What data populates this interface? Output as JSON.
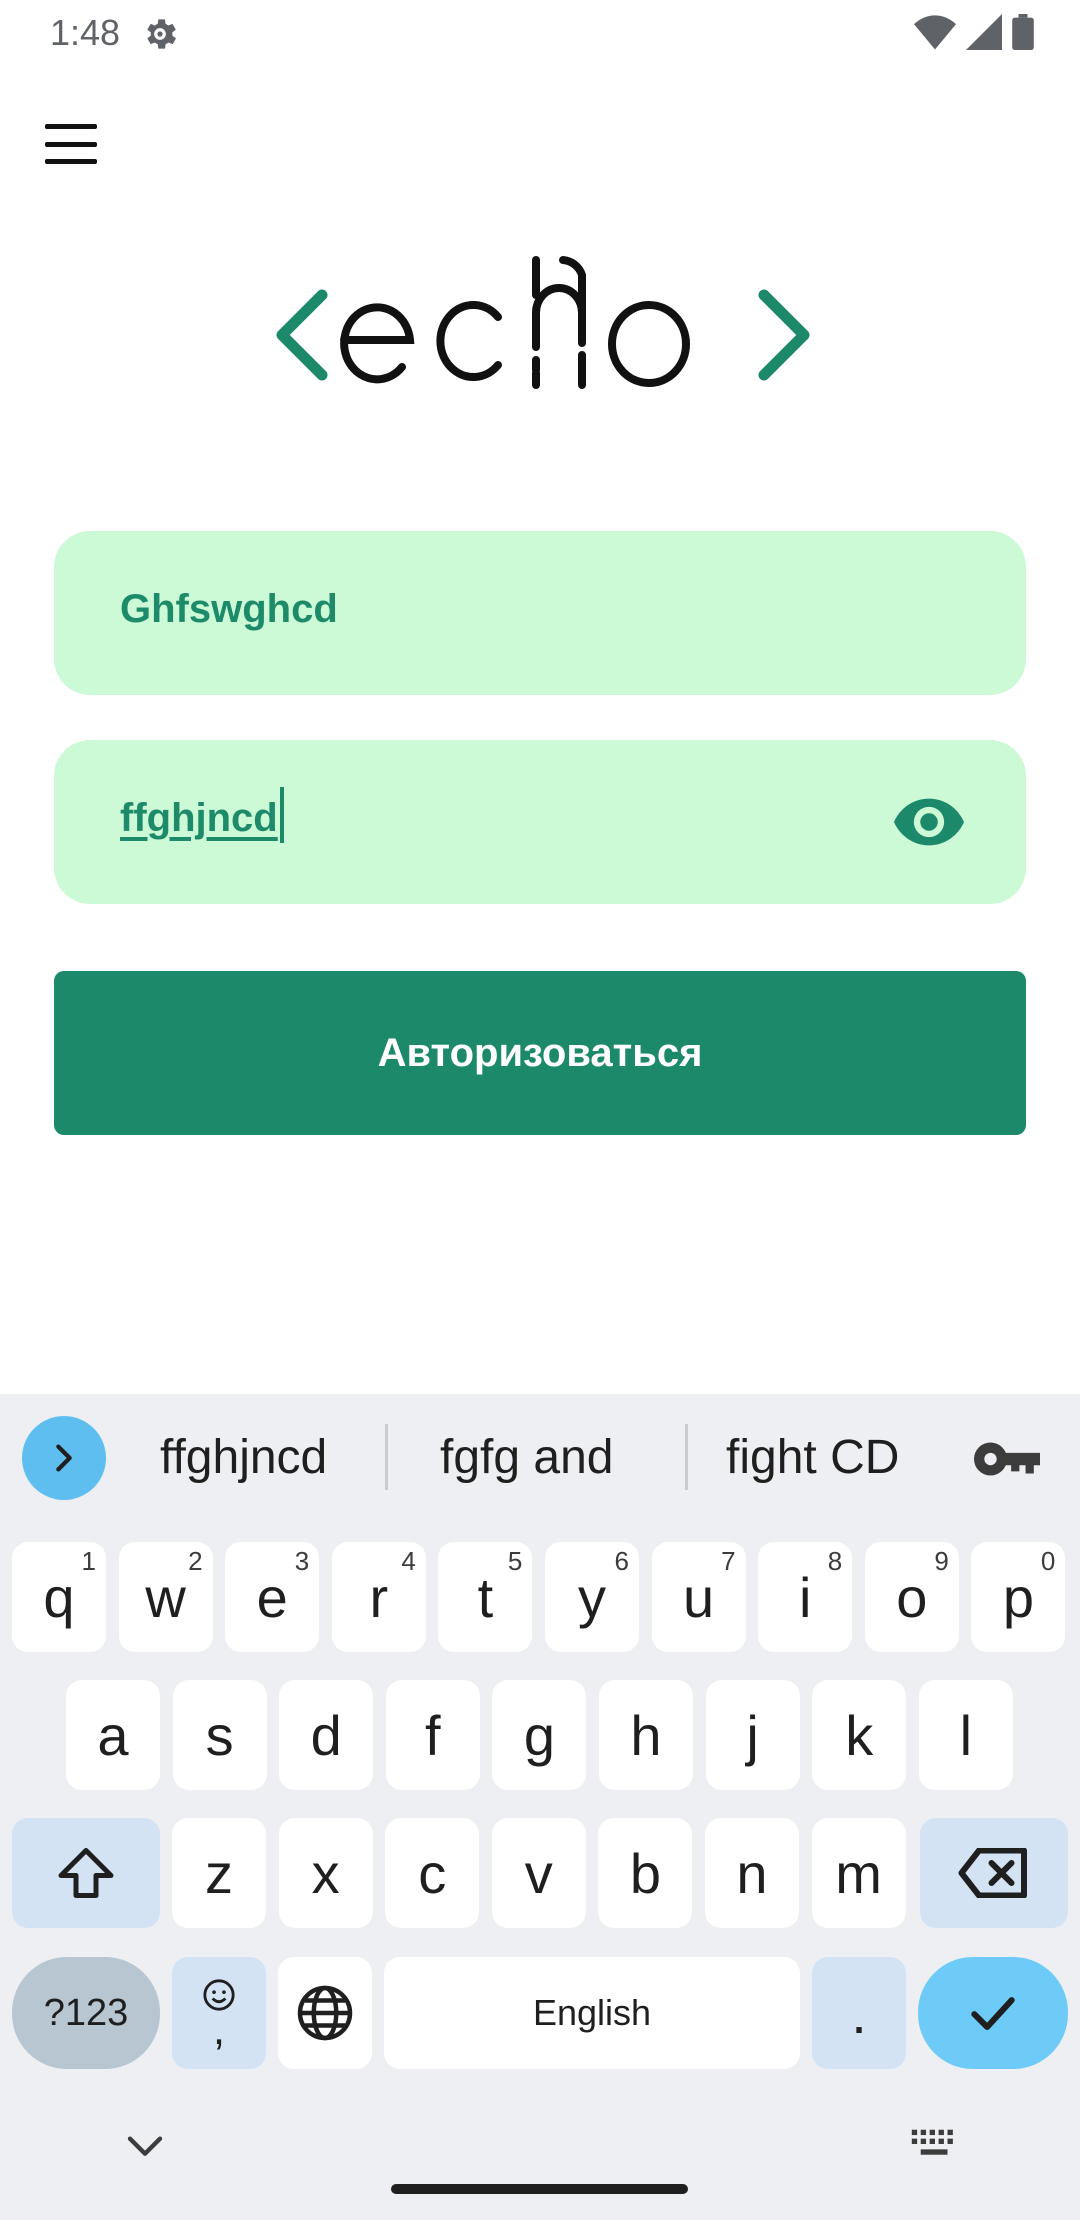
{
  "status_bar": {
    "time": "1:48"
  },
  "login": {
    "username_value": "Ghfswghcd",
    "password_value": "ffghjncd",
    "submit_label": "Авторизоваться"
  },
  "colors": {
    "field_bg": "#ccf9d6",
    "accent": "#1c896b",
    "logo_bracket": "#1c896b",
    "keyboard_bg": "#eeeff3",
    "enter_key": "#6ecbf8"
  },
  "keyboard": {
    "suggestions": [
      "ffghjncd",
      "fgfg and",
      "fight CD"
    ],
    "row1": [
      {
        "k": "q",
        "h": "1"
      },
      {
        "k": "w",
        "h": "2"
      },
      {
        "k": "e",
        "h": "3"
      },
      {
        "k": "r",
        "h": "4"
      },
      {
        "k": "t",
        "h": "5"
      },
      {
        "k": "y",
        "h": "6"
      },
      {
        "k": "u",
        "h": "7"
      },
      {
        "k": "i",
        "h": "8"
      },
      {
        "k": "o",
        "h": "9"
      },
      {
        "k": "p",
        "h": "0"
      }
    ],
    "row2": [
      "a",
      "s",
      "d",
      "f",
      "g",
      "h",
      "j",
      "k",
      "l"
    ],
    "row3": [
      "z",
      "x",
      "c",
      "v",
      "b",
      "n",
      "m"
    ],
    "symbols_label": "?123",
    "comma_label": ",",
    "space_label": "English",
    "period_label": "."
  },
  "icons": {
    "status": [
      "gear-icon",
      "wifi-icon",
      "signal-icon",
      "battery-icon"
    ],
    "menu": "hamburger-menu-icon",
    "eye": "eye-icon",
    "expand": "chevron-right-icon",
    "key": "password-key-icon",
    "shift": "shift-icon",
    "backspace": "backspace-icon",
    "emoji": "emoji-icon",
    "globe": "globe-icon",
    "enter": "checkmark-icon",
    "hide_keyboard": "chevron-down-icon",
    "keyboard_switch": "keyboard-icon"
  }
}
